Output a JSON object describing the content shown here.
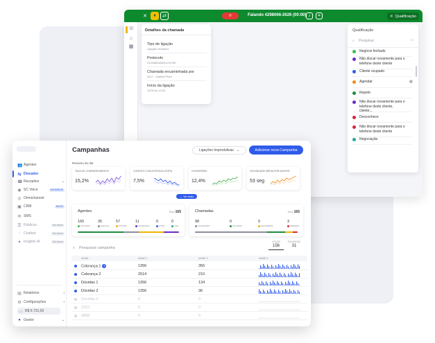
{
  "call_window": {
    "status": "Falando 4298066-2626 (00:00)",
    "qualify_label": "Qualificação",
    "details": {
      "title": "Detalhes da chamada",
      "items": [
        {
          "label": "Tipo de ligação",
          "value": "Ligação receptiva"
        },
        {
          "label": "Protocolo",
          "value": "2124465444511211780"
        },
        {
          "label": "Chamada encaminhada por",
          "value": "0417 - Gabriel Pires"
        },
        {
          "label": "Início da ligação",
          "value": "12/05 às 14:32"
        }
      ]
    },
    "qualification": {
      "title": "Qualificação",
      "search_placeholder": "Pesquisar",
      "items": [
        {
          "label": "Negócio fechado",
          "color": "#3fb950"
        },
        {
          "label": "Não discar novamente para o telefone deste cliente",
          "color": "#6a2cc4"
        },
        {
          "label": "Cliente ocupado",
          "color": "#2f5bea"
        },
        {
          "label": "Agendar",
          "color": "#f08c1a"
        },
        {
          "label": "Repetir",
          "color": "#1f8a3b"
        },
        {
          "label": "Não discar novamente para o telefone deste cliente, cliente...",
          "color": "#6a2cc4"
        },
        {
          "label": "Desconhece",
          "color": "#d6263b"
        },
        {
          "label": "Não discar novamente para o telefone deste cliente",
          "color": "#d6263b"
        },
        {
          "label": "Negociação",
          "color": "#26a69a"
        }
      ]
    }
  },
  "sidebar": {
    "items": [
      {
        "label": "Agentes",
        "icon": "agents-icon"
      },
      {
        "label": "Discador",
        "icon": "dialer-icon"
      },
      {
        "label": "Receptivo",
        "icon": "inbound-icon"
      },
      {
        "label": "SC Voice",
        "icon": "voice-icon",
        "pill": "EM BREVE"
      },
      {
        "label": "Omnichannel",
        "icon": "omnichannel-icon"
      },
      {
        "label": "CRM",
        "icon": "crm-icon",
        "pill": "NOVO"
      },
      {
        "label": "SMS",
        "icon": "sms-icon"
      },
      {
        "label": "Públicos",
        "icon": "audience-icon",
        "pill": "Em breve"
      },
      {
        "label": "Chatbot",
        "icon": "chatbot-icon",
        "pill": "Em breve"
      },
      {
        "label": "Insights IA",
        "icon": "insights-icon",
        "pill": "Em breve"
      }
    ],
    "bottom": [
      {
        "label": "Relatórios",
        "icon": "reports-icon"
      },
      {
        "label": "Configurações",
        "icon": "settings-icon"
      },
      {
        "label": "R$ 5.721,00",
        "icon": "wallet-icon"
      },
      {
        "label": "Gestor",
        "icon": "user-icon"
      }
    ]
  },
  "campaigns": {
    "title": "Campanhas",
    "filter_label": "Ligações Improdutivas",
    "add_label": "Adicionar nova Campanha",
    "summary_label": "Resumo do dia",
    "kpis": [
      {
        "label": "TAXA DE COMPARECIMENTO",
        "value": "15,2%",
        "color": "#7b5cd6"
      },
      {
        "label": "CONTATO COM A PESSOA CERTA",
        "value": "7,5%",
        "color": "#2f5bea"
      },
      {
        "label": "CONVERSÃO",
        "value": "12,4%",
        "color": "#4caf50"
      },
      {
        "label": "OCIOSIDADE MÉDIA POR AGENTE",
        "value": "53 seg",
        "color": "#f08c1a"
      }
    ],
    "more_label": "Ver mais",
    "agents": {
      "title": "Agentes",
      "total_label": "Total",
      "total": "165",
      "stats": [
        {
          "value": "165",
          "label": "FALANDO",
          "color": "#4caf50"
        },
        {
          "value": "35",
          "label": "MANUAL",
          "color": "#8a8d99"
        },
        {
          "value": "57",
          "label": "OCIOSO",
          "color": "#f0b400"
        },
        {
          "value": "11",
          "label": "INTERVALO",
          "color": "#6a2cc4"
        },
        {
          "value": "0",
          "label": "ATIVA",
          "color": "#2f5bea"
        },
        {
          "value": "0",
          "label": "TMA",
          "color": "#26a69a"
        }
      ],
      "bar_colors": [
        "#1f8a3b",
        "#8a8d99",
        "#f0b400",
        "#6a2cc4"
      ]
    },
    "calls": {
      "title": "Chamadas",
      "total_label": "Total",
      "total": "165",
      "stats": [
        {
          "value": "98",
          "label": "CHAMANDO",
          "color": "#8a8d99"
        },
        {
          "value": "0",
          "label": "FALANDO",
          "color": "#1f8a3b"
        },
        {
          "value": "0",
          "label": "EM ESPERA",
          "color": "#f0b400"
        },
        {
          "value": "3",
          "label": "PERDIDA",
          "color": "#d6263b"
        }
      ],
      "bar_colors": [
        "#8a8d99",
        "#1f8a3b",
        "#f0b400",
        "#d6263b"
      ]
    },
    "search_placeholder": "Pesquisar campanha",
    "tabs": [
      {
        "label": "ATIVAS",
        "count": "156"
      },
      {
        "label": "PAUSADAS",
        "count": "31"
      }
    ],
    "columns": [
      "NOME ↑",
      "NOME 2",
      "NOME 3",
      "NOME 4"
    ],
    "rows": [
      {
        "name": "Cobrança 1",
        "badge": "2",
        "col2": "1356",
        "col3": "356",
        "disabled": false
      },
      {
        "name": "Cobrança 2",
        "badge": "",
        "col2": "2514",
        "col3": "210",
        "disabled": false
      },
      {
        "name": "Dúvidas 1",
        "badge": "",
        "col2": "1356",
        "col3": "134",
        "disabled": false
      },
      {
        "name": "Dúvidas 2",
        "badge": "",
        "col2": "1356",
        "col3": "36",
        "disabled": false
      },
      {
        "name": "Dúvidas 3",
        "badge": "",
        "col2": "0",
        "col3": "0",
        "disabled": true
      },
      {
        "name": "1023",
        "badge": "",
        "col2": "0",
        "col3": "0",
        "disabled": true
      },
      {
        "name": "9888",
        "badge": "",
        "col2": "0",
        "col3": "0",
        "disabled": true
      }
    ]
  }
}
